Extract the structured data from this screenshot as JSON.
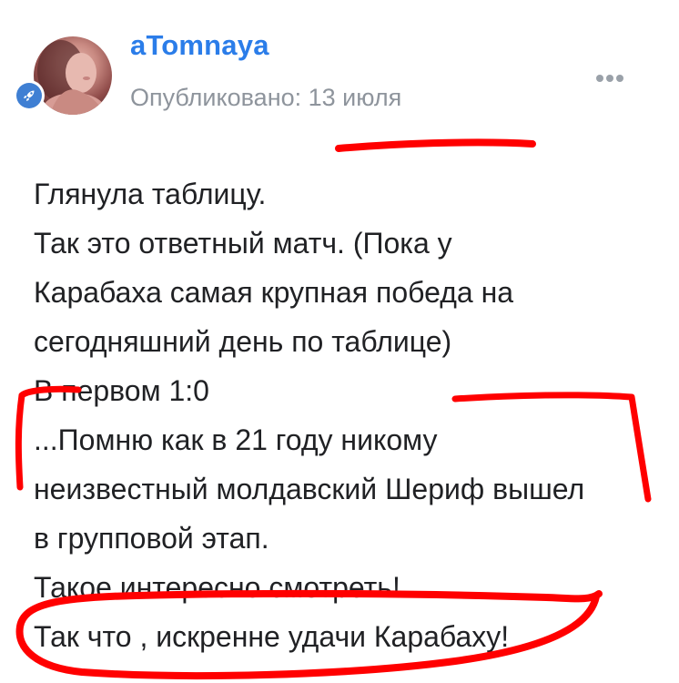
{
  "post": {
    "author": "aTomnaya",
    "published": "Опубликовано: 13 июля",
    "lines": [
      "Глянула таблицу.",
      "Так это ответный матч. (Пока у",
      "Карабаха  самая крупная победа на",
      "сегодняшний день по таблице)",
      "В первом 1:0",
      "...Помню как в 21 году никому",
      "неизвестный молдавский Шериф вышел",
      "в групповой этап.",
      "Такое интересно смотреть!",
      "Так что , искренне удачи Карабаху!"
    ]
  },
  "icons": {
    "avatar_badge": "rocket-icon",
    "more": "more-dots-icon"
  },
  "colors": {
    "author": "#2b7de9",
    "meta": "#8e949c",
    "text": "#202124",
    "badge": "#3f7fd3",
    "annotation": "#ff0000"
  }
}
